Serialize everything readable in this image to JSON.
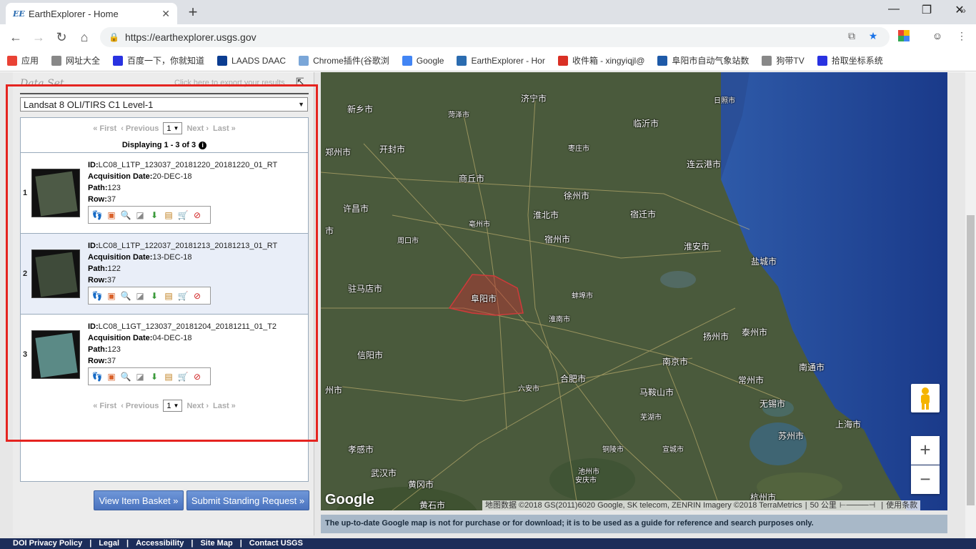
{
  "browser": {
    "tab_title": "EarthExplorer - Home",
    "tab_favicon": "EE",
    "url": "https://earthexplorer.usgs.gov",
    "bookmarks": [
      {
        "label": "应用",
        "icon": "apps-grid-icon",
        "color": "#e94235"
      },
      {
        "label": "网址大全",
        "icon": "page-icon",
        "color": "#888888"
      },
      {
        "label": "百度一下，你就知道",
        "icon": "baidu-paw-icon",
        "color": "#2932e1"
      },
      {
        "label": "LAADS DAAC",
        "icon": "nasa-icon",
        "color": "#0b3d91"
      },
      {
        "label": "Chrome插件(谷歌浏",
        "icon": "plugin-icon",
        "color": "#7aa6d8"
      },
      {
        "label": "Google",
        "icon": "google-g-icon",
        "color": "#4285f4"
      },
      {
        "label": "EarthExplorer - Hor",
        "icon": "ee-icon",
        "color": "#2b6cb0"
      },
      {
        "label": "收件箱 - xingyiqjl@",
        "icon": "gmail-icon",
        "color": "#d93025"
      },
      {
        "label": "阜阳市自动气象站数",
        "icon": "globe-icon",
        "color": "#1e5aa8"
      },
      {
        "label": "狗带TV",
        "icon": "page-icon",
        "color": "#888888"
      },
      {
        "label": "拾取坐标系统",
        "icon": "baidu-paw-icon",
        "color": "#2932e1"
      }
    ]
  },
  "panel": {
    "dataset_title": "Data Set",
    "export_text": "Click here to export your results",
    "dataset_selected": "Landsat 8 OLI/TIRS C1 Level-1",
    "pager": {
      "first": "« First",
      "previous": "‹ Previous",
      "page": "1",
      "next": "Next ›",
      "last": "Last »"
    },
    "displaying": "Displaying 1 - 3 of 3",
    "results": [
      {
        "num": "1",
        "id": "LC08_L1TP_123037_20181220_20181220_01_RT",
        "date": "20-DEC-18",
        "path": "123",
        "row": "37",
        "thumb_color": "#4d5a46"
      },
      {
        "num": "2",
        "id": "LC08_L1TP_122037_20181213_20181213_01_RT",
        "date": "13-DEC-18",
        "path": "122",
        "row": "37",
        "thumb_color": "#3f4b3a"
      },
      {
        "num": "3",
        "id": "LC08_L1GT_123037_20181204_20181211_01_T2",
        "date": "04-DEC-18",
        "path": "123",
        "row": "37",
        "thumb_color": "#5b8a86"
      }
    ],
    "labels": {
      "id": "ID:",
      "date": "Acquisition Date:",
      "path": "Path:",
      "row": "Row:"
    },
    "buttons": {
      "basket": "View Item Basket »",
      "standing": "Submit Standing Request »"
    }
  },
  "map": {
    "labels": [
      {
        "text": "济宁市"
      },
      {
        "text": "日照市"
      },
      {
        "text": "新乡市"
      },
      {
        "text": "菏泽市"
      },
      {
        "text": "临沂市"
      },
      {
        "text": "郑州市"
      },
      {
        "text": "开封市"
      },
      {
        "text": "枣庄市"
      },
      {
        "text": "连云港市"
      },
      {
        "text": "商丘市"
      },
      {
        "text": "徐州市"
      },
      {
        "text": "许昌市"
      },
      {
        "text": "淮北市"
      },
      {
        "text": "宿迁市"
      },
      {
        "text": "亳州市"
      },
      {
        "text": "周口市"
      },
      {
        "text": "宿州市"
      },
      {
        "text": "淮安市"
      },
      {
        "text": "盐城市"
      },
      {
        "text": "驻马店市"
      },
      {
        "text": "阜阳市"
      },
      {
        "text": "蚌埠市"
      },
      {
        "text": "淮南市"
      },
      {
        "text": "扬州市"
      },
      {
        "text": "泰州市"
      },
      {
        "text": "信阳市"
      },
      {
        "text": "南京市"
      },
      {
        "text": "合肥市"
      },
      {
        "text": "南通市"
      },
      {
        "text": "常州市"
      },
      {
        "text": "六安市"
      },
      {
        "text": "马鞍山市"
      },
      {
        "text": "无锡市"
      },
      {
        "text": "芜湖市"
      },
      {
        "text": "苏州市"
      },
      {
        "text": "上海市"
      },
      {
        "text": "孝感市"
      },
      {
        "text": "铜陵市"
      },
      {
        "text": "宣城市"
      },
      {
        "text": "武汉市"
      },
      {
        "text": "池州市"
      },
      {
        "text": "黄冈市"
      },
      {
        "text": "安庆市"
      },
      {
        "text": "杭州市"
      },
      {
        "text": "黄石市"
      },
      {
        "text": "州市"
      },
      {
        "text": "市"
      }
    ],
    "attribution": "地图数据 ©2018 GS(2011)6020 Google, SK telecom, ZENRIN Imagery ©2018 TerraMetrics",
    "scale": "50 公里",
    "terms": "使用条款",
    "google": "Google",
    "note": "The up-to-date Google map is not for purchase or for download; it is to be used as a guide for reference and search purposes only."
  },
  "footer": [
    "DOI Privacy Policy",
    "|",
    "Legal",
    "|",
    "Accessibility",
    "|",
    "Site Map",
    "|",
    "Contact USGS"
  ]
}
